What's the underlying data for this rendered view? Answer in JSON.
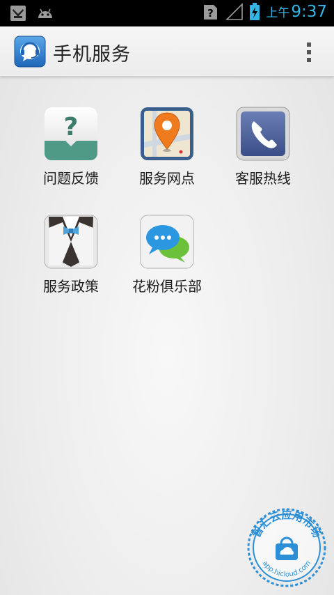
{
  "status_bar": {
    "ampm": "上午",
    "time": "9:37",
    "icons": [
      "notification-icon",
      "android-icon",
      "unknown-sim-icon",
      "signal-icon",
      "battery-charging-icon"
    ]
  },
  "action_bar": {
    "title": "手机服务",
    "logo_icon": "headset-chat-icon",
    "overflow_icon": "overflow-menu-icon"
  },
  "grid": {
    "items": [
      {
        "label": "问题反馈",
        "icon": "question-bubble-icon"
      },
      {
        "label": "服务网点",
        "icon": "map-pin-icon"
      },
      {
        "label": "客服热线",
        "icon": "phone-icon"
      },
      {
        "label": "服务政策",
        "icon": "tuxedo-icon"
      },
      {
        "label": "花粉俱乐部",
        "icon": "chat-bubbles-icon"
      }
    ]
  },
  "watermark": {
    "top_text": "智汇云应用市场",
    "bottom_text": "app.hicloud.com"
  },
  "colors": {
    "accent": "#33b5e5",
    "title_text": "#222222",
    "watermark_blue": "#2a8fd6"
  }
}
